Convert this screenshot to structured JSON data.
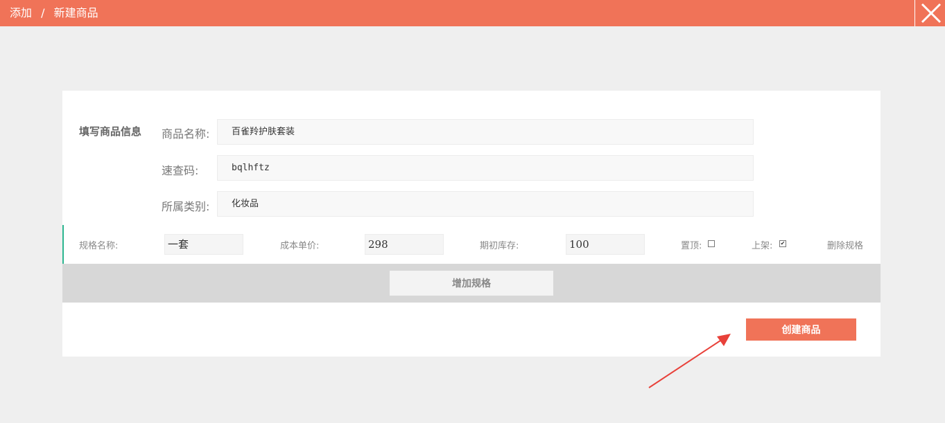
{
  "header": {
    "crumb_parent": "添加",
    "crumb_sep": "/",
    "crumb_current": "新建商品"
  },
  "form": {
    "section_title": "填写商品信息",
    "name_label": "商品名称:",
    "name_value": "百雀羚护肤套装",
    "code_label": "速查码:",
    "code_value": "bqlhftz",
    "category_label": "所属类别:",
    "category_value": "化妆品"
  },
  "spec": {
    "name_label": "规格名称:",
    "name_value": "一套",
    "cost_label": "成本单价:",
    "cost_value": "298",
    "stock_label": "期初库存:",
    "stock_value": "100",
    "top_label": "置顶:",
    "top_checked": false,
    "shelf_label": "上架:",
    "shelf_checked": true,
    "delete_label": "删除规格"
  },
  "actions": {
    "add_spec": "增加规格",
    "create": "创建商品"
  },
  "colors": {
    "accent": "#f07358",
    "spec_border": "#2bb58f",
    "arrow": "#e8413a"
  }
}
